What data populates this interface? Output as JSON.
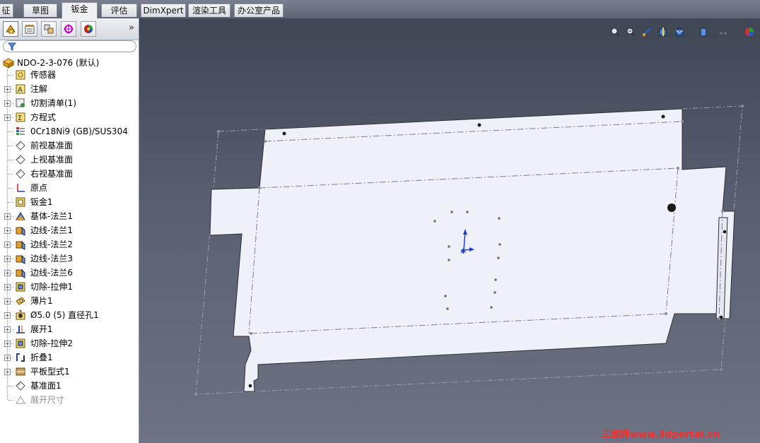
{
  "tabs": [
    {
      "label": "征",
      "active": false
    },
    {
      "label": "草图",
      "active": false
    },
    {
      "label": "钣金",
      "active": true
    },
    {
      "label": "评估",
      "active": false
    },
    {
      "label": "DimXpert",
      "active": false
    },
    {
      "label": "渲染工具",
      "active": false
    },
    {
      "label": "办公室产品",
      "active": false
    }
  ],
  "panel_tabs": [
    {
      "icon": "feature-manager-icon",
      "active": true
    },
    {
      "icon": "property-manager-icon",
      "active": false
    },
    {
      "icon": "configuration-manager-icon",
      "active": false
    },
    {
      "icon": "dimxpert-manager-icon",
      "active": false
    },
    {
      "icon": "display-manager-icon",
      "active": false
    }
  ],
  "panel_more": "»",
  "tree": {
    "root": "NDO-2-3-076  (默认)",
    "items": [
      {
        "label": "传感器",
        "icon": "sensor-icon",
        "expandable": false
      },
      {
        "label": "注解",
        "icon": "annotation-icon",
        "expandable": true
      },
      {
        "label": "切割清单(1)",
        "icon": "cut-list-icon",
        "expandable": true
      },
      {
        "label": "方程式",
        "icon": "equation-icon",
        "expandable": true
      },
      {
        "label": "0Cr18Ni9 (GB)/SUS304",
        "icon": "material-icon",
        "expandable": false
      },
      {
        "label": "前视基准面",
        "icon": "plane-icon",
        "expandable": false
      },
      {
        "label": "上视基准面",
        "icon": "plane-icon",
        "expandable": false
      },
      {
        "label": "右视基准面",
        "icon": "plane-icon",
        "expandable": false
      },
      {
        "label": "原点",
        "icon": "origin-icon",
        "expandable": false
      },
      {
        "label": "钣金1",
        "icon": "sheet-metal-icon",
        "expandable": false
      },
      {
        "label": "基体-法兰1",
        "icon": "base-flange-icon",
        "expandable": true
      },
      {
        "label": "边线-法兰1",
        "icon": "edge-flange-icon",
        "expandable": true
      },
      {
        "label": "边线-法兰2",
        "icon": "edge-flange-icon",
        "expandable": true
      },
      {
        "label": "边线-法兰3",
        "icon": "edge-flange-icon",
        "expandable": true
      },
      {
        "label": "边线-法兰6",
        "icon": "edge-flange-icon",
        "expandable": true
      },
      {
        "label": "切除-拉伸1",
        "icon": "cut-extrude-icon",
        "expandable": true
      },
      {
        "label": "薄片1",
        "icon": "tab-feature-icon",
        "expandable": true
      },
      {
        "label": "Ø5.0 (5) 直径孔1",
        "icon": "hole-wizard-icon",
        "expandable": true
      },
      {
        "label": "展开1",
        "icon": "unfold-icon",
        "expandable": true
      },
      {
        "label": "切除-拉伸2",
        "icon": "cut-extrude-icon",
        "expandable": true
      },
      {
        "label": "折叠1",
        "icon": "fold-icon",
        "expandable": true
      },
      {
        "label": "平板型式1",
        "icon": "flat-pattern-icon",
        "expandable": true
      },
      {
        "label": "基准面1",
        "icon": "plane-icon",
        "expandable": false
      },
      {
        "label": "展开尺寸",
        "icon": "flat-dimension-icon",
        "expandable": false,
        "suppressed": true
      }
    ]
  },
  "view_toolbar": [
    "zoom-to-fit-icon",
    "zoom-area-icon",
    "previous-view-icon",
    "section-view-icon",
    "view-orientation-icon",
    "display-style-icon",
    "hide-show-icon",
    "edit-appearance-icon",
    "apply-scene-icon",
    "view-settings-icon"
  ],
  "watermark": "三维网www.3dportal.cn",
  "colors": {
    "part_face": "#eef1f7",
    "viewport_top": "#3f4654",
    "viewport_bottom": "#6e7383",
    "watermark": "#ff2a2a"
  }
}
